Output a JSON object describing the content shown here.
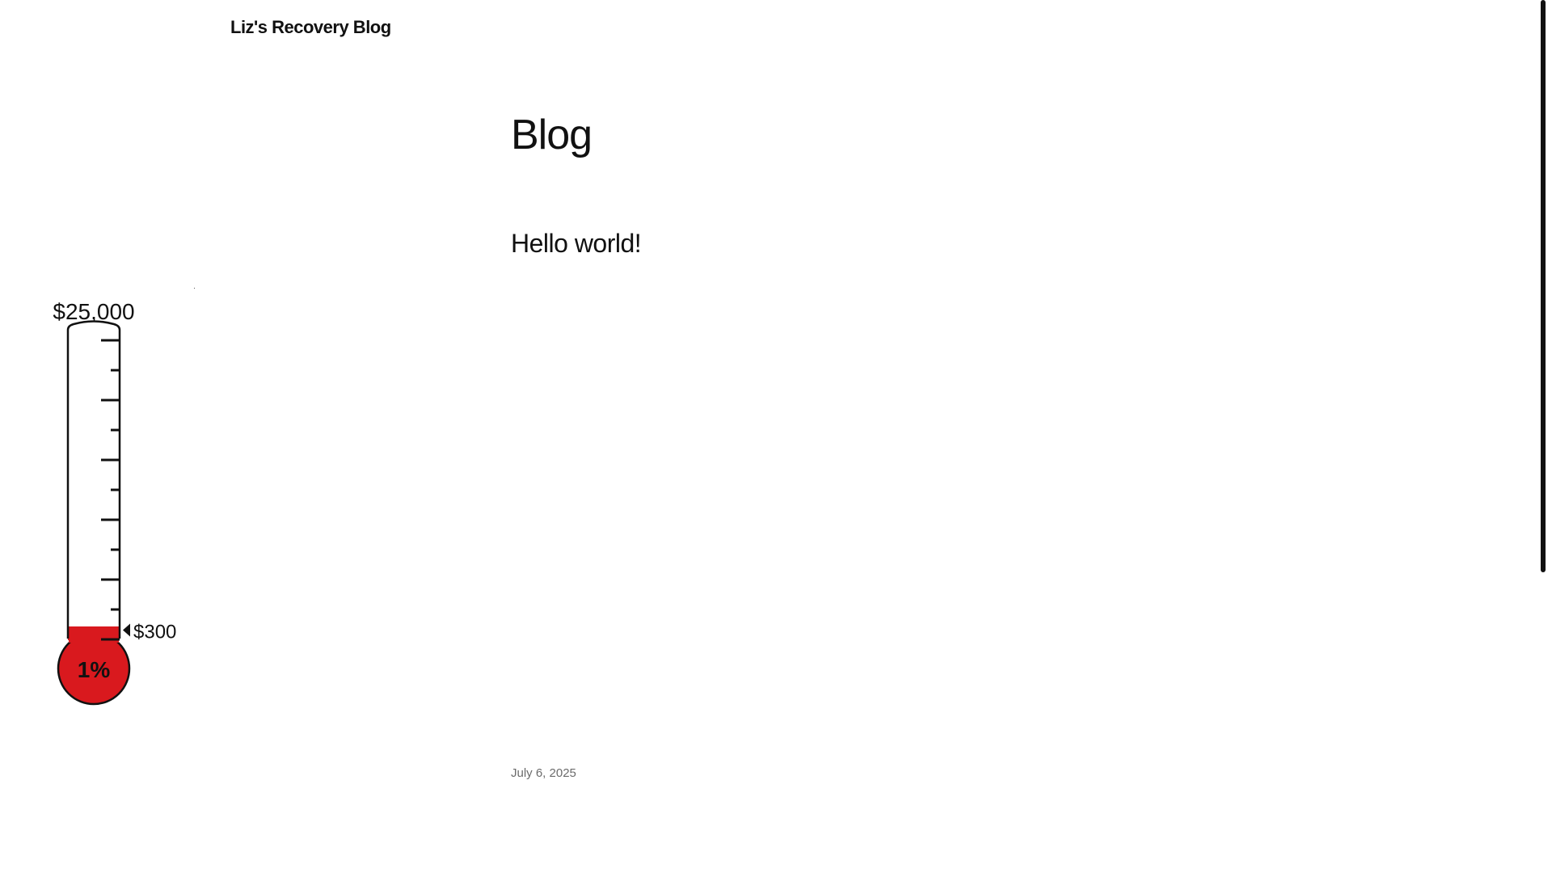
{
  "header": {
    "site_title": "Liz's Recovery Blog"
  },
  "main": {
    "heading": "Blog",
    "posts": [
      {
        "title": "Hello world!",
        "date": "July 6, 2025"
      }
    ]
  },
  "fundraiser": {
    "goal_label": "$25,000",
    "raised_label": "$300",
    "percent_label": "1%",
    "goal_amount": 25000,
    "raised_amount": 300,
    "fill_color": "#d9191e",
    "outline_color": "#111111"
  }
}
